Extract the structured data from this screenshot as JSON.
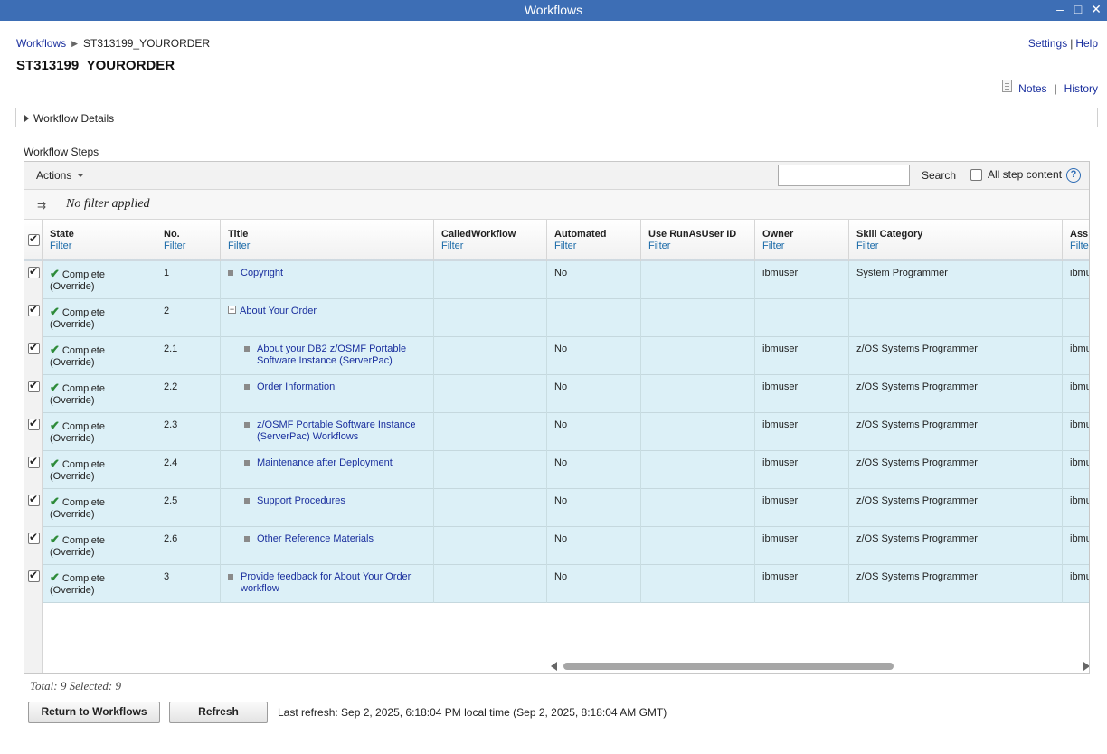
{
  "window": {
    "title": "Workflows",
    "controls": [
      "minimize",
      "maximize",
      "close"
    ]
  },
  "breadcrumb": {
    "root": "Workflows",
    "current": "ST313199_YOURORDER"
  },
  "page_title": "ST313199_YOURORDER",
  "top_links": {
    "settings": "Settings",
    "help": "Help"
  },
  "note_links": {
    "notes": "Notes",
    "history": "History"
  },
  "details_section": {
    "label": "Workflow Details"
  },
  "steps_label": "Workflow Steps",
  "toolbar": {
    "actions_label": "Actions",
    "search_value": "",
    "search_label": "Search",
    "all_step_content": "All step content",
    "all_step_content_checked": false
  },
  "filter_status": "No filter applied",
  "columns": [
    {
      "label": "State",
      "filter": "Filter"
    },
    {
      "label": "No.",
      "filter": "Filter"
    },
    {
      "label": "Title",
      "filter": "Filter"
    },
    {
      "label": "CalledWorkflow",
      "filter": "Filter"
    },
    {
      "label": "Automated",
      "filter": "Filter"
    },
    {
      "label": "Use RunAsUser ID",
      "filter": "Filter"
    },
    {
      "label": "Owner",
      "filter": "Filter"
    },
    {
      "label": "Skill Category",
      "filter": "Filter"
    },
    {
      "label": "Ass",
      "filter": "Filte"
    }
  ],
  "rows": [
    {
      "selected": true,
      "state": "Complete",
      "state_note": "(Override)",
      "no": "1",
      "title": [
        "Copyright"
      ],
      "level": 0,
      "expander": "none",
      "called": "",
      "automated": "No",
      "runas": "",
      "owner": "ibmuser",
      "skill": "System Programmer",
      "assignee": "ibmu"
    },
    {
      "selected": true,
      "state": "Complete",
      "state_note": "(Override)",
      "no": "2",
      "title": [
        "About Your Order"
      ],
      "level": 0,
      "expander": "minus",
      "called": "",
      "automated": "",
      "runas": "",
      "owner": "",
      "skill": "",
      "assignee": ""
    },
    {
      "selected": true,
      "state": "Complete",
      "state_note": "(Override)",
      "no": "2.1",
      "title": [
        "About your DB2 z/OSMF Portable",
        "Software Instance (ServerPac)"
      ],
      "level": 1,
      "expander": "none",
      "called": "",
      "automated": "No",
      "runas": "",
      "owner": "ibmuser",
      "skill": "z/OS Systems Programmer",
      "assignee": "ibmu"
    },
    {
      "selected": true,
      "state": "Complete",
      "state_note": "(Override)",
      "no": "2.2",
      "title": [
        "Order Information"
      ],
      "level": 1,
      "expander": "none",
      "called": "",
      "automated": "No",
      "runas": "",
      "owner": "ibmuser",
      "skill": "z/OS Systems Programmer",
      "assignee": "ibmu"
    },
    {
      "selected": true,
      "state": "Complete",
      "state_note": "(Override)",
      "no": "2.3",
      "title": [
        "z/OSMF Portable Software Instance",
        "(ServerPac) Workflows"
      ],
      "level": 1,
      "expander": "none",
      "called": "",
      "automated": "No",
      "runas": "",
      "owner": "ibmuser",
      "skill": "z/OS Systems Programmer",
      "assignee": "ibmu"
    },
    {
      "selected": true,
      "state": "Complete",
      "state_note": "(Override)",
      "no": "2.4",
      "title": [
        "Maintenance after Deployment"
      ],
      "level": 1,
      "expander": "none",
      "called": "",
      "automated": "No",
      "runas": "",
      "owner": "ibmuser",
      "skill": "z/OS Systems Programmer",
      "assignee": "ibmu"
    },
    {
      "selected": true,
      "state": "Complete",
      "state_note": "(Override)",
      "no": "2.5",
      "title": [
        "Support Procedures"
      ],
      "level": 1,
      "expander": "none",
      "called": "",
      "automated": "No",
      "runas": "",
      "owner": "ibmuser",
      "skill": "z/OS Systems Programmer",
      "assignee": "ibmu"
    },
    {
      "selected": true,
      "state": "Complete",
      "state_note": "(Override)",
      "no": "2.6",
      "title": [
        "Other Reference Materials"
      ],
      "level": 1,
      "expander": "none",
      "called": "",
      "automated": "No",
      "runas": "",
      "owner": "ibmuser",
      "skill": "z/OS Systems Programmer",
      "assignee": "ibmu"
    },
    {
      "selected": true,
      "state": "Complete",
      "state_note": "(Override)",
      "no": "3",
      "title": [
        "Provide feedback for About Your Order",
        "workflow"
      ],
      "level": 0,
      "expander": "none",
      "called": "",
      "automated": "No",
      "runas": "",
      "owner": "ibmuser",
      "skill": "z/OS Systems Programmer",
      "assignee": "ibmu"
    }
  ],
  "footer": {
    "total_text": "Total: 9 Selected: 9",
    "return_button": "Return to Workflows",
    "refresh_button": "Refresh",
    "last_refresh": "Last refresh: Sep 2, 2025, 6:18:04 PM local time (Sep 2, 2025, 8:18:04 AM GMT)"
  },
  "colors": {
    "titlebar": "#3d6eb5",
    "link": "#1a2f9e",
    "row_bg": "#dcf0f7",
    "check_green": "#2e8b3a"
  }
}
